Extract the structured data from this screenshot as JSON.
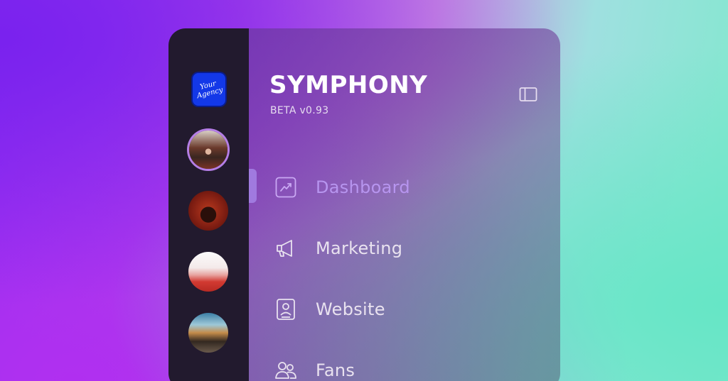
{
  "brand": {
    "name": "SYMPHONY",
    "version": "BETA v0.93"
  },
  "agency": {
    "logo_text": "Your Agency"
  },
  "rail": {
    "avatars": [
      {
        "name": "artist-avatar-1"
      },
      {
        "name": "artist-avatar-2"
      },
      {
        "name": "artist-avatar-3"
      },
      {
        "name": "artist-avatar-4"
      }
    ]
  },
  "nav": {
    "items": [
      {
        "label": "Dashboard",
        "icon": "chart-trend-icon",
        "active": true
      },
      {
        "label": "Marketing",
        "icon": "megaphone-icon",
        "active": false
      },
      {
        "label": "Website",
        "icon": "profile-card-icon",
        "active": false
      },
      {
        "label": "Fans",
        "icon": "users-icon",
        "active": false
      }
    ]
  },
  "colors": {
    "rail_bg": "#221a2e",
    "active_accent": "#a07adf",
    "active_text": "#b795ef",
    "agency_logo_bg": "#1338e8"
  }
}
